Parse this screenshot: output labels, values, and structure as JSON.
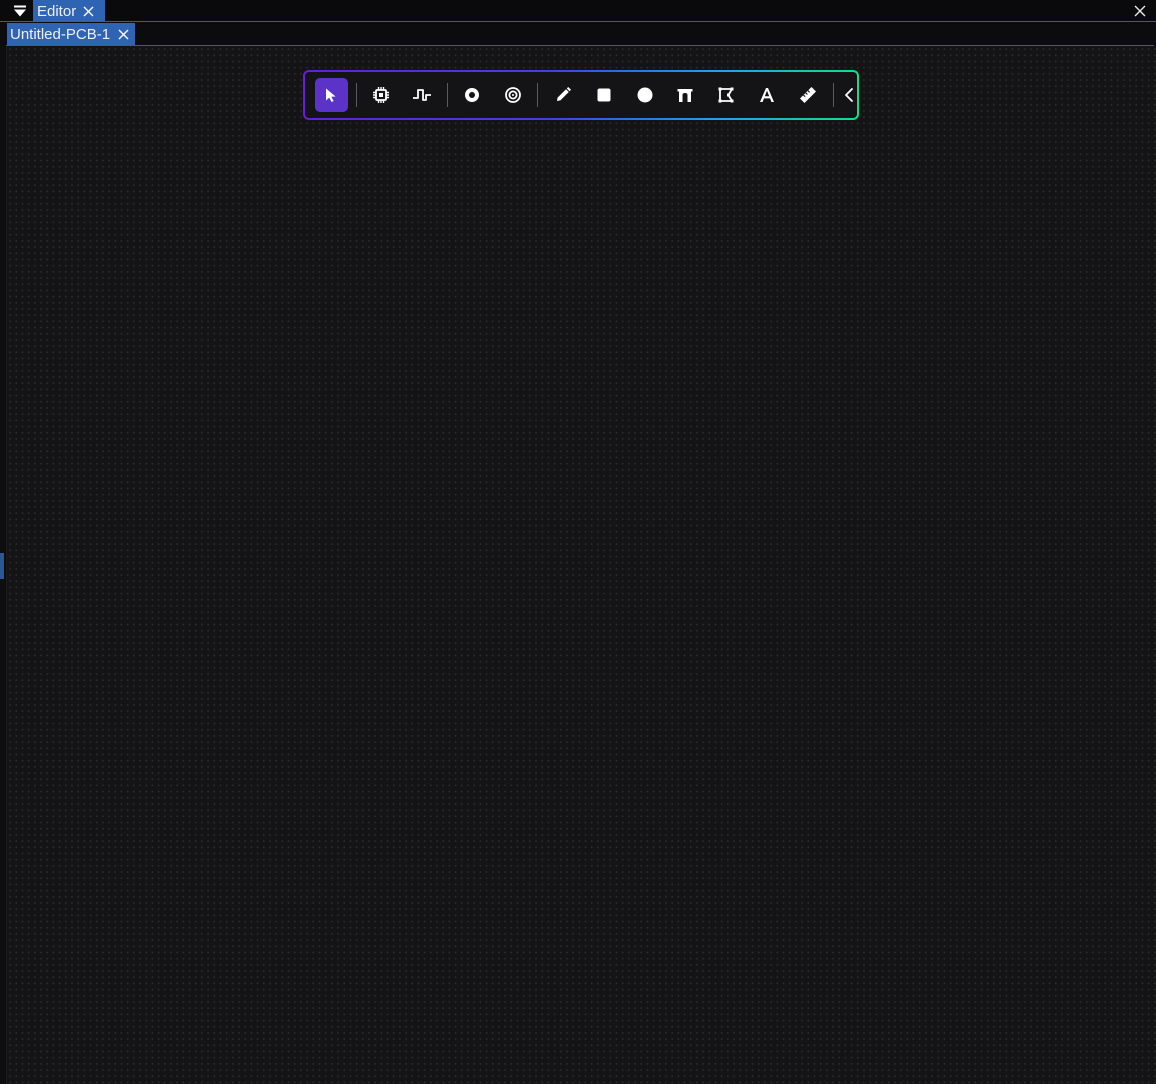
{
  "panel": {
    "tab_label": "Editor"
  },
  "document": {
    "tab_label": "Untitled-PCB-1"
  },
  "toolbar": {
    "active_tool": "select",
    "tools": [
      "select",
      "component",
      "trace",
      "via",
      "pad-ring",
      "draw",
      "rectangle",
      "circle",
      "arch",
      "polygon",
      "text",
      "measure",
      "collapse"
    ]
  },
  "colors": {
    "accent_tab": "#2f64b3",
    "active_tool": "#5b33c9",
    "gradient_start": "#6a1be0",
    "gradient_end": "#0ee08a",
    "canvas": "#141416"
  }
}
